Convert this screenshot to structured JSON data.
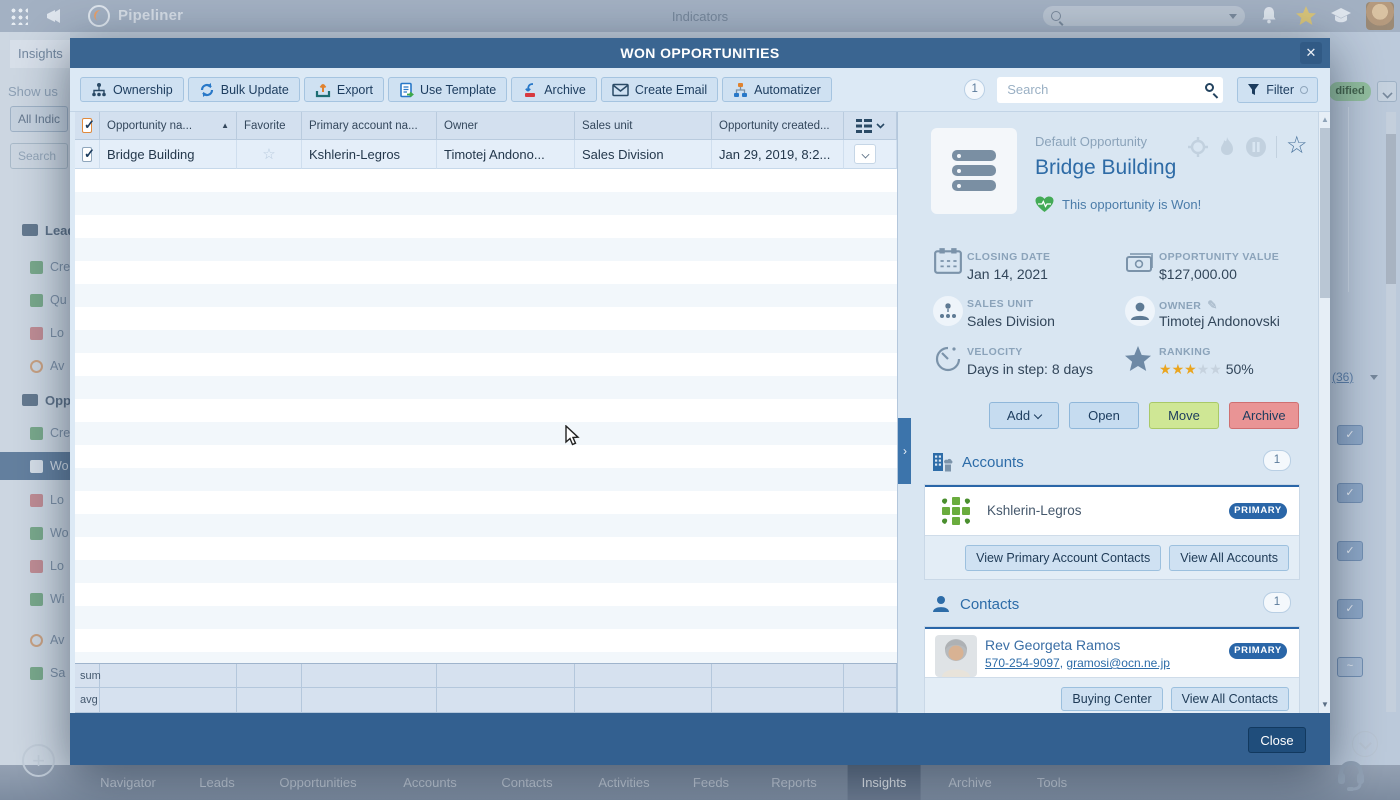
{
  "colors": {
    "accent": "#2d6ca8",
    "titlebar": "#3a6591",
    "won_green": "#44ab57",
    "primary_badge": "#2a66a8",
    "move_btn": "#cfe795",
    "archive_btn": "#e99495"
  },
  "topbar": {
    "app_name": "Pipeliner",
    "page_title": "Indicators"
  },
  "backdrop": {
    "tab": "Insights",
    "show_us": "Show us",
    "all_indicators": "All Indic",
    "search_placeholder": "Search",
    "modified_badge": "dified",
    "link_36": "(36)",
    "sidebar": [
      {
        "label": "Lead"
      },
      {
        "label": "Cre"
      },
      {
        "label": "Qu"
      },
      {
        "label": "Lo"
      },
      {
        "label": "Av"
      },
      {
        "label": "Opp"
      },
      {
        "label": "Cre"
      },
      {
        "label": "Wo"
      },
      {
        "label": "Lo"
      },
      {
        "label": "Wo"
      },
      {
        "label": "Lo"
      },
      {
        "label": "Wi"
      },
      {
        "label": "Av"
      },
      {
        "label": "Sa"
      }
    ],
    "nav": [
      "Navigator",
      "Leads",
      "Opportunities",
      "Accounts",
      "Contacts",
      "Activities",
      "Feeds",
      "Reports",
      "Insights",
      "Archive",
      "Tools"
    ],
    "active_nav": "Insights"
  },
  "modal": {
    "title": "WON OPPORTUNITIES",
    "close_x": "✕",
    "toolbar": [
      {
        "label": "Ownership"
      },
      {
        "label": "Bulk Update"
      },
      {
        "label": "Export"
      },
      {
        "label": "Use Template"
      },
      {
        "label": "Archive"
      },
      {
        "label": "Create Email"
      },
      {
        "label": "Automatizer"
      }
    ],
    "count_badge": "1",
    "search_placeholder": "Search",
    "filter_label": "Filter",
    "table": {
      "columns": [
        "Opportunity na...",
        "Favorite",
        "Primary account na...",
        "Owner",
        "Sales unit",
        "Opportunity created..."
      ],
      "sort_indicator": "▲",
      "favorite_star": "☆",
      "row": {
        "opportunity": "Bridge Building",
        "primary_account": "Kshlerin-Legros",
        "owner": "Timotej Andono...",
        "sales_unit": "Sales Division",
        "created": "Jan 29, 2019, 8:2..."
      },
      "sum_label": "sum",
      "avg_label": "avg"
    },
    "close_label": "Close"
  },
  "panel": {
    "type_label": "Default Opportunity",
    "title": "Bridge Building",
    "won_message": "This opportunity is Won!",
    "fields": [
      {
        "label": "CLOSING DATE",
        "value": "Jan 14, 2021"
      },
      {
        "label": "OPPORTUNITY VALUE",
        "value": "$127,000.00"
      },
      {
        "label": "SALES UNIT",
        "value": "Sales Division"
      },
      {
        "label": "OWNER",
        "value": "Timotej Andonovski"
      },
      {
        "label": "VELOCITY",
        "value": "Days in step: 8 days"
      },
      {
        "label": "RANKING",
        "value": "50%"
      }
    ],
    "ranking": {
      "filled": 3,
      "total": 5,
      "percent": "50%"
    },
    "actions": {
      "add": "Add",
      "open": "Open",
      "move": "Move",
      "archive": "Archive"
    },
    "accounts": {
      "title": "Accounts",
      "count": "1",
      "name": "Kshlerin-Legros",
      "badge": "PRIMARY",
      "btn_primary_contacts": "View Primary Account Contacts",
      "btn_all": "View All Accounts"
    },
    "contacts": {
      "title": "Contacts",
      "count": "1",
      "name": "Rev Georgeta Ramos",
      "phone": "570-254-9097",
      "email": "gramosi@ocn.ne.jp",
      "badge": "PRIMARY",
      "btn_buying": "Buying Center",
      "btn_all": "View All Contacts"
    }
  }
}
